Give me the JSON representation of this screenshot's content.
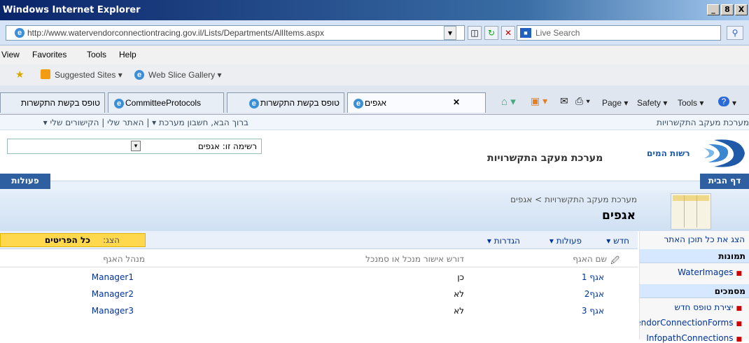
{
  "window": {
    "title": "Windows Internet Explorer",
    "min": "_",
    "restore": "8",
    "close": "X"
  },
  "address": {
    "url": "http://www.watervendorconnectiontracing.gov.il/Lists/Departments/AllItems.aspx",
    "search_placeholder": "Live Search"
  },
  "menu": [
    "View",
    "Favorites",
    "Tools",
    "Help"
  ],
  "favorites": {
    "suggested": "Suggested Sites ▾",
    "slice": "Web Slice Gallery ▾"
  },
  "tabs": [
    {
      "label": "טופס בקשת התקשרות"
    },
    {
      "label": "CommitteeProtocols"
    },
    {
      "label": "טופס בקשת התקשרות"
    },
    {
      "label": "אגפים"
    }
  ],
  "commands": {
    "page": "Page ▾",
    "safety": "Safety ▾",
    "tools": "Tools ▾",
    "help": "▾"
  },
  "sp": {
    "site_crumb": "מערכת מעקב התקשרויות",
    "welcome": "ברוך הבא, חשבון מערכת ▾ | האתר שלי | הקישורים שלי ▾",
    "logo_text": "רשות המים",
    "site_title": "מערכת מעקב התקשרויות",
    "list_selector": "רשימה זו: אגפים",
    "home_tab": "דף הבית",
    "site_actions": "פעולות",
    "breadcrumb": "מערכת מעקב התקשרויות > אגפים",
    "page_title": "אגפים",
    "view_all": "הצג את כל תוכן האתר",
    "view_label": "הצג:",
    "view_value": "כל הפריטים"
  },
  "toolbar": {
    "new": "חדש ▾",
    "actions": "פעולות ▾",
    "settings": "הגדרות ▾"
  },
  "quick": {
    "pictures": "תמונות",
    "pictures_items": [
      "WaterImages"
    ],
    "documents": "מסמכים",
    "documents_items": [
      "יצירת טופס חדש",
      "VendorConnectionForms",
      "InfopathConnections"
    ]
  },
  "columns": {
    "name": "שם האגף",
    "requires": "דורש אישור מנכל או סמנכל",
    "manager": "מנהל האגף"
  },
  "rows": [
    {
      "name": "אגף 1",
      "requires": "כן",
      "manager": "Manager1"
    },
    {
      "name": "אגף2",
      "requires": "לא",
      "manager": "Manager2"
    },
    {
      "name": "אגף 3",
      "requires": "לא",
      "manager": "Manager3"
    }
  ],
  "colors": {
    "accent": "#0a246a",
    "link": "#003399",
    "highlight": "#ffd84d"
  }
}
